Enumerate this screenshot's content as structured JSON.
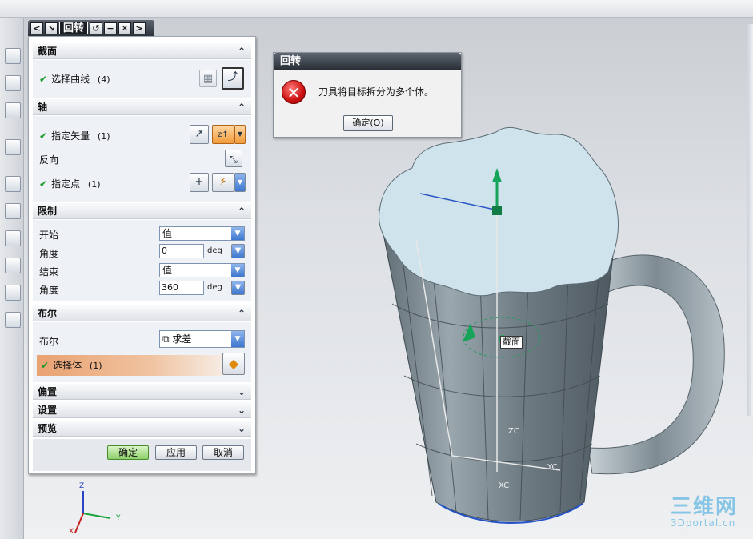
{
  "dialog": {
    "title": "回转",
    "sections": {
      "section": {
        "title": "截面",
        "select_curve_label": "选择曲线",
        "select_curve_count": "(4)"
      },
      "axis": {
        "title": "轴",
        "specify_vector_label": "指定矢量",
        "specify_vector_count": "(1)",
        "vector_value": "z↑",
        "reverse_label": "反向",
        "specify_point_label": "指定点",
        "specify_point_count": "(1)"
      },
      "limits": {
        "title": "限制",
        "start_label": "开始",
        "start_type": "值",
        "start_angle_label": "角度",
        "start_angle_value": "0",
        "end_label": "结束",
        "end_type": "值",
        "end_angle_label": "角度",
        "end_angle_value": "360",
        "unit": "deg"
      },
      "boolean": {
        "title": "布尔",
        "boolean_label": "布尔",
        "boolean_value": "求差",
        "select_body_label": "选择体",
        "select_body_count": "(1)"
      },
      "offset": {
        "title": "偏置"
      },
      "settings": {
        "title": "设置"
      },
      "preview": {
        "title": "预览"
      }
    },
    "buttons": {
      "ok": "确定",
      "apply": "应用",
      "cancel": "取消"
    }
  },
  "error_dialog": {
    "title": "回转",
    "message": "刀具将目标拆分为多个体。",
    "ok_button": "确定(O)"
  },
  "viewport": {
    "tag_label": "截面",
    "wcs_labels": {
      "zc": "ZC",
      "yc": "YC",
      "xc": "XC"
    },
    "triad_labels": {
      "z": "Z",
      "y": "Y",
      "x": "X"
    }
  },
  "watermark": {
    "line1": "三维网",
    "line2": "3Dportal.cn"
  },
  "colors": {
    "accent_orange": "#f29a3b",
    "check_green": "#1a9b2c",
    "top_face": "#cfe3ec",
    "body": "#7c8a92"
  }
}
